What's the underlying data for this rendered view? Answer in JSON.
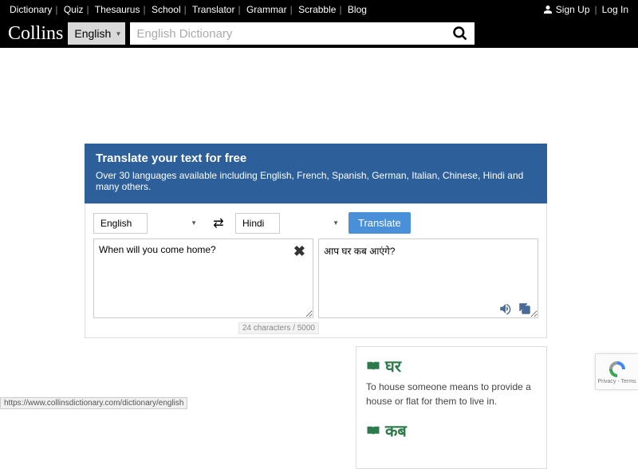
{
  "topnav": [
    "Dictionary",
    "Quiz",
    "Thesaurus",
    "School",
    "Translator",
    "Grammar",
    "Scrabble",
    "Blog"
  ],
  "auth": {
    "signup": "Sign Up",
    "login": "Log In"
  },
  "logo": "Collins",
  "langSelector": "English",
  "searchPlaceholder": "English Dictionary",
  "banner": {
    "title": "Translate your text for free",
    "subtitle": "Over 30 languages available including English, French, Spanish, German, Italian, Chinese, Hindi and many others."
  },
  "translator": {
    "fromLang": "English",
    "toLang": "Hindi",
    "translateBtn": "Translate",
    "input": "When will you come home?",
    "output": "आप घर कब आएंगे?",
    "counter": "24 characters / 5000"
  },
  "results": [
    {
      "word": "घर",
      "def": "To house someone means to provide a house or flat for them to live in."
    },
    {
      "word": "कब",
      "def": ""
    }
  ],
  "statusUrl": "https://www.collinsdictionary.com/dictionary/english",
  "recaptcha": "Privacy - Terms"
}
